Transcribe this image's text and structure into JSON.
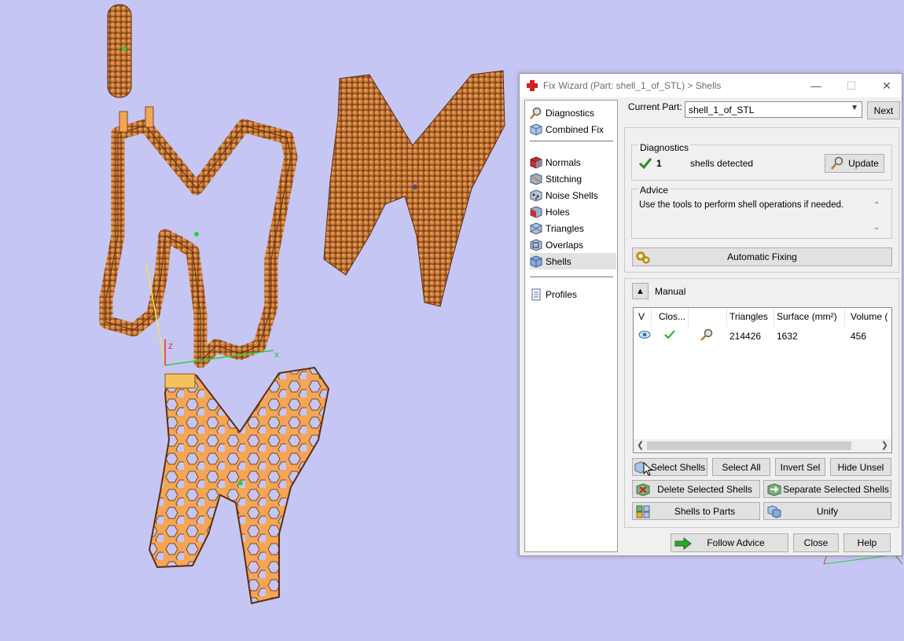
{
  "window": {
    "title": "Fix Wizard (Part: shell_1_of_STL) > Shells",
    "minimize": "—",
    "maximize": "☐",
    "close": "✕"
  },
  "nav": {
    "items_top": [
      {
        "label": "Diagnostics",
        "icon": "magnifier-icon"
      },
      {
        "label": "Combined Fix",
        "icon": "cube-icon"
      }
    ],
    "items_mid": [
      {
        "label": "Normals",
        "icon": "normals-cube-icon"
      },
      {
        "label": "Stitching",
        "icon": "stitch-cube-icon"
      },
      {
        "label": "Noise Shells",
        "icon": "noise-cube-icon"
      },
      {
        "label": "Holes",
        "icon": "holes-cube-icon"
      },
      {
        "label": "Triangles",
        "icon": "triangles-cube-icon"
      },
      {
        "label": "Overlaps",
        "icon": "overlaps-cube-icon"
      },
      {
        "label": "Shells",
        "icon": "shells-cube-icon",
        "selected": true
      }
    ],
    "items_bottom": [
      {
        "label": "Profiles",
        "icon": "document-icon"
      }
    ]
  },
  "current_part": {
    "label": "Current Part:",
    "value": "shell_1_of_STL",
    "next_label": "Next"
  },
  "diagnostics": {
    "heading": "Diagnostics",
    "count": "1",
    "text": "shells detected",
    "update_label": "Update"
  },
  "advice": {
    "heading": "Advice",
    "text": "Use the tools to perform shell operations if needed."
  },
  "automatic_fixing_label": "Automatic Fixing",
  "manual": {
    "label": "Manual",
    "columns": [
      "V",
      "Clos...",
      "",
      "Triangles",
      "Surface (mm²)",
      "Volume ("
    ],
    "rows": [
      {
        "triangles": "214426",
        "surface": "1632",
        "volume": "456"
      }
    ]
  },
  "buttons": {
    "select_shells": "Select Shells",
    "select_all": "Select All",
    "invert_sel": "Invert Sel",
    "hide_unsel": "Hide Unsel",
    "delete_selected": "Delete Selected Shells",
    "separate_selected": "Separate Selected Shells",
    "shells_to_parts": "Shells to Parts",
    "unify": "Unify",
    "follow_advice": "Follow Advice",
    "close": "Close",
    "help": "Help"
  },
  "viewport": {
    "axis_x": "x",
    "axis_z": "z",
    "background": "#c6c6f4",
    "model_color": "#c87a3c",
    "mesh_color": "#f5a556"
  }
}
